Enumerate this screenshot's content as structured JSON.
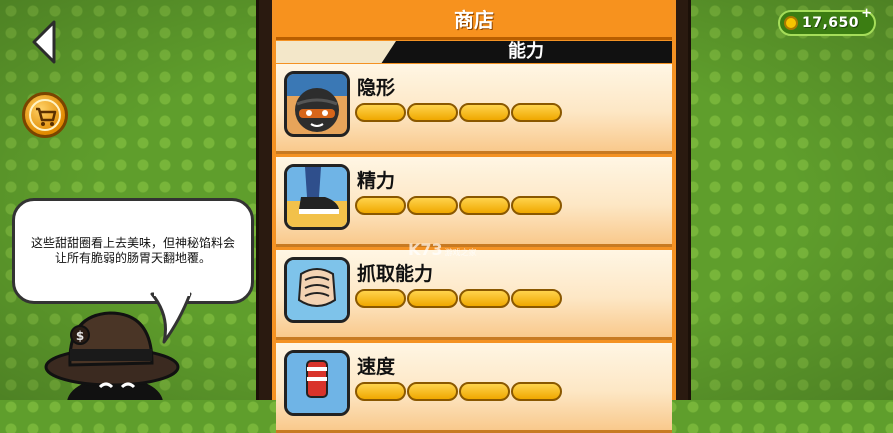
{
  "navigation": {
    "back_icon": "back-arrow-icon"
  },
  "header": {
    "shop_icon": "shopping-cart-icon"
  },
  "coins": {
    "value": "17,650",
    "plus": "+",
    "accent": "#f6c400"
  },
  "shop": {
    "title": "商店",
    "tab": "能力",
    "items": [
      {
        "name": "隐形",
        "icon": "masked-thief-icon",
        "level_segments": 4
      },
      {
        "name": "精力",
        "icon": "running-shoe-icon",
        "level_segments": 4
      },
      {
        "name": "抓取能力",
        "icon": "grabbing-hand-icon",
        "level_segments": 4
      },
      {
        "name": "速度",
        "icon": "roller-skate-icon",
        "level_segments": 4
      }
    ]
  },
  "hint": {
    "text": "这些甜甜圈看上去美味，但神秘馅料会让所有脆弱的肠胃天翻地覆。"
  },
  "watermark": {
    "main": "K73",
    "sub": "游戏之家"
  },
  "colors": {
    "background": "#5f9e2c",
    "panel_orange": "#f7921e",
    "bar_gold": "#f0a800"
  }
}
